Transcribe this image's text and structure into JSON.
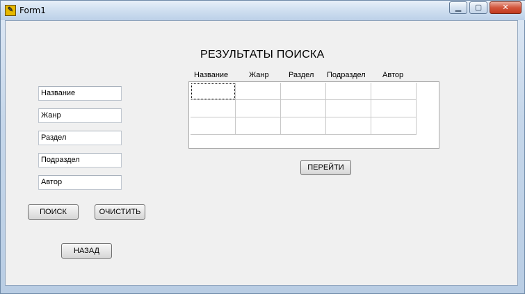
{
  "window": {
    "title": "Form1",
    "controls": {
      "minimize": "▁",
      "maximize": "▢",
      "close": "✕"
    }
  },
  "heading": "РЕЗУЛЬТАТЫ ПОИСКА",
  "fields": [
    {
      "name": "title",
      "value": "Название"
    },
    {
      "name": "genre",
      "value": "Жанр"
    },
    {
      "name": "section",
      "value": "Раздел"
    },
    {
      "name": "subsection",
      "value": "Подраздел"
    },
    {
      "name": "author",
      "value": "Автор"
    }
  ],
  "buttons": {
    "search": "ПОИСК",
    "clear": "ОЧИСТИТЬ",
    "back": "НАЗАД",
    "go": "ПЕРЕЙТИ"
  },
  "results_table": {
    "columns": [
      "Название",
      "Жанр",
      "Раздел",
      "Подраздел",
      "Автор"
    ],
    "rows": [
      [
        "",
        "",
        "",
        "",
        ""
      ],
      [
        "",
        "",
        "",
        "",
        ""
      ],
      [
        "",
        "",
        "",
        "",
        ""
      ]
    ]
  }
}
